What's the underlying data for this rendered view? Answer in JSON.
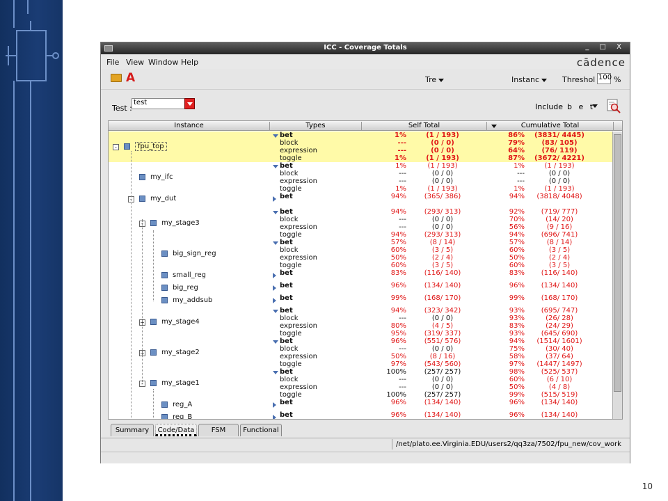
{
  "window": {
    "title": "ICC - Coverage Totals",
    "controls": "_ □ X",
    "brand": "cādence"
  },
  "menu": [
    "File",
    "View",
    "Window",
    "Help"
  ],
  "toolbar": {
    "tree_label": "Tre",
    "instance_label": "Instanc",
    "threshold_label": "Threshol",
    "threshold_value": "100",
    "percent": "%"
  },
  "filter": {
    "test_label": "Test :",
    "test_value": "test",
    "include_label": "Include",
    "include_value": "b e t"
  },
  "grid": {
    "headers": [
      "Instance",
      "Types",
      "Self Total",
      "Cumulative Total"
    ],
    "rows": [
      {
        "name": "fpu_top",
        "types": [
          "bet",
          "block",
          "expression",
          "toggle"
        ],
        "self_pct": [
          "1%",
          "---",
          "---",
          "1%"
        ],
        "self_cnt": [
          "(1 / 193)",
          "(0 / 0)",
          "(0 / 0)",
          "(1 / 193)"
        ],
        "cum_pct": [
          "86%",
          "79%",
          "64%",
          "87%"
        ],
        "cum_cnt": [
          "(3831/ 4445)",
          "(83/ 105)",
          "(76/ 119)",
          "(3672/ 4221)"
        ]
      },
      {
        "name": "my_ifc",
        "types": [
          "bet",
          "block",
          "expression",
          "toggle"
        ],
        "self_pct": [
          "1%",
          "---",
          "---",
          "1%"
        ],
        "self_cnt": [
          "(1 / 193)",
          "(0 / 0)",
          "(0 / 0)",
          "(1 / 193)"
        ],
        "cum_pct": [
          "1%",
          "---",
          "---",
          "1%"
        ],
        "cum_cnt": [
          "(1 / 193)",
          "(0 / 0)",
          "(0 / 0)",
          "(1 / 193)"
        ]
      },
      {
        "name": "my_dut",
        "types": [
          "bet"
        ],
        "self_pct": [
          "94%"
        ],
        "self_cnt": [
          "(365/ 386)"
        ],
        "cum_pct": [
          "94%"
        ],
        "cum_cnt": [
          "(3818/ 4048)"
        ]
      },
      {
        "name": "my_stage3",
        "types": [
          "bet",
          "block",
          "expression",
          "toggle"
        ],
        "self_pct": [
          "94%",
          "---",
          "---",
          "94%"
        ],
        "self_cnt": [
          "(293/ 313)",
          "(0 / 0)",
          "(0 / 0)",
          "(293/ 313)"
        ],
        "cum_pct": [
          "92%",
          "70%",
          "56%",
          "94%"
        ],
        "cum_cnt": [
          "(719/ 777)",
          "(14/ 20)",
          "(9 / 16)",
          "(696/ 741)"
        ]
      },
      {
        "name": "big_sign_reg",
        "types": [
          "bet",
          "block",
          "expression",
          "toggle"
        ],
        "self_pct": [
          "57%",
          "60%",
          "50%",
          "60%"
        ],
        "self_cnt": [
          "(8 / 14)",
          "(3 / 5)",
          "(2 / 4)",
          "(3 / 5)"
        ],
        "cum_pct": [
          "57%",
          "60%",
          "50%",
          "60%"
        ],
        "cum_cnt": [
          "(8 / 14)",
          "(3 / 5)",
          "(2 / 4)",
          "(3 / 5)"
        ]
      },
      {
        "name": "small_reg",
        "types": [
          "bet"
        ],
        "self_pct": [
          "83%"
        ],
        "self_cnt": [
          "(116/ 140)"
        ],
        "cum_pct": [
          "83%"
        ],
        "cum_cnt": [
          "(116/ 140)"
        ]
      },
      {
        "name": "big_reg",
        "types": [
          "bet"
        ],
        "self_pct": [
          "96%"
        ],
        "self_cnt": [
          "(134/ 140)"
        ],
        "cum_pct": [
          "96%"
        ],
        "cum_cnt": [
          "(134/ 140)"
        ]
      },
      {
        "name": "my_addsub",
        "types": [
          "bet"
        ],
        "self_pct": [
          "99%"
        ],
        "self_cnt": [
          "(168/ 170)"
        ],
        "cum_pct": [
          "99%"
        ],
        "cum_cnt": [
          "(168/ 170)"
        ]
      },
      {
        "name": "my_stage4",
        "types": [
          "bet",
          "block",
          "expression",
          "toggle"
        ],
        "self_pct": [
          "94%",
          "---",
          "80%",
          "95%"
        ],
        "self_cnt": [
          "(323/ 342)",
          "(0 / 0)",
          "(4 / 5)",
          "(319/ 337)"
        ],
        "cum_pct": [
          "93%",
          "93%",
          "83%",
          "93%"
        ],
        "cum_cnt": [
          "(695/ 747)",
          "(26/ 28)",
          "(24/ 29)",
          "(645/ 690)"
        ]
      },
      {
        "name": "my_stage2",
        "types": [
          "bet",
          "block",
          "expression",
          "toggle"
        ],
        "self_pct": [
          "96%",
          "---",
          "50%",
          "97%"
        ],
        "self_cnt": [
          "(551/ 576)",
          "(0 / 0)",
          "(8 / 16)",
          "(543/ 560)"
        ],
        "cum_pct": [
          "94%",
          "75%",
          "58%",
          "97%"
        ],
        "cum_cnt": [
          "(1514/ 1601)",
          "(30/ 40)",
          "(37/ 64)",
          "(1447/ 1497)"
        ]
      },
      {
        "name": "my_stage1",
        "types": [
          "bet",
          "block",
          "expression",
          "toggle"
        ],
        "self_pct": [
          "100%",
          "---",
          "---",
          "100%"
        ],
        "self_cnt": [
          "(257/ 257)",
          "(0 / 0)",
          "(0 / 0)",
          "(257/ 257)"
        ],
        "cum_pct": [
          "98%",
          "60%",
          "50%",
          "99%"
        ],
        "cum_cnt": [
          "(525/ 537)",
          "(6 / 10)",
          "(4 / 8)",
          "(515/ 519)"
        ]
      },
      {
        "name": "reg_A",
        "types": [
          "bet"
        ],
        "self_pct": [
          "96%"
        ],
        "self_cnt": [
          "(134/ 140)"
        ],
        "cum_pct": [
          "96%"
        ],
        "cum_cnt": [
          "(134/ 140)"
        ]
      },
      {
        "name": "reg_B",
        "types": [
          "bet"
        ],
        "self_pct": [
          "96%"
        ],
        "self_cnt": [
          "(134/ 140)"
        ],
        "cum_pct": [
          "96%"
        ],
        "cum_cnt": [
          "(134/ 140)"
        ]
      }
    ]
  },
  "tabs": [
    "Summary",
    "Code/Data",
    "FSM",
    "Functional"
  ],
  "status": {
    "path": "/net/plato.ee.Virginia.EDU/users2/qq3za/7502/fpu_new/cov_work"
  },
  "page_number": "10",
  "colors": {
    "sidebar": "#1a3c74",
    "selected_row": "#fffaa8",
    "low_coverage": "#e01515",
    "brand_red": "#c8161d"
  }
}
